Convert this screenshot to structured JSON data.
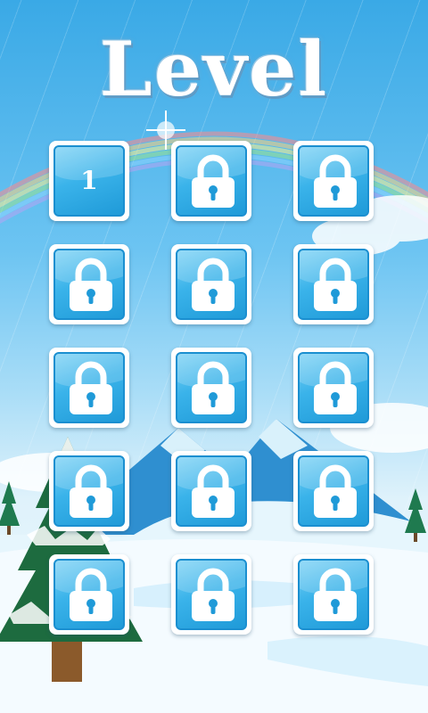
{
  "title": "Level",
  "levels": [
    {
      "label": "1",
      "locked": false
    },
    {
      "label": "",
      "locked": true
    },
    {
      "label": "",
      "locked": true
    },
    {
      "label": "",
      "locked": true
    },
    {
      "label": "",
      "locked": true
    },
    {
      "label": "",
      "locked": true
    },
    {
      "label": "",
      "locked": true
    },
    {
      "label": "",
      "locked": true
    },
    {
      "label": "",
      "locked": true
    },
    {
      "label": "",
      "locked": true
    },
    {
      "label": "",
      "locked": true
    },
    {
      "label": "",
      "locked": true
    },
    {
      "label": "",
      "locked": true
    },
    {
      "label": "",
      "locked": true
    },
    {
      "label": "",
      "locked": true
    }
  ],
  "colors": {
    "sky_top": "#3aa9e6",
    "tile_blue": "#3ab3ea",
    "tile_border": "#1b8fd0"
  }
}
